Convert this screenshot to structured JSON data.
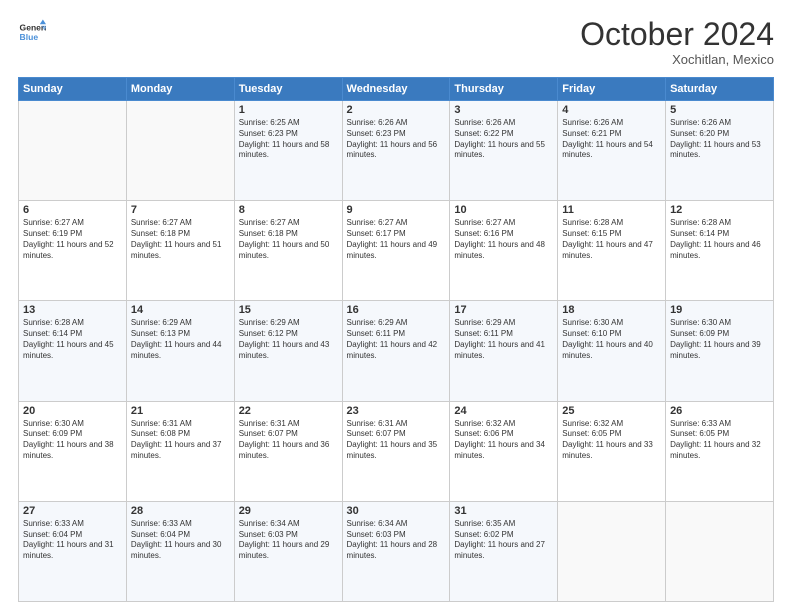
{
  "header": {
    "logo_line1": "General",
    "logo_line2": "Blue",
    "month": "October 2024",
    "location": "Xochitlan, Mexico"
  },
  "weekdays": [
    "Sunday",
    "Monday",
    "Tuesday",
    "Wednesday",
    "Thursday",
    "Friday",
    "Saturday"
  ],
  "weeks": [
    [
      {
        "day": "",
        "info": ""
      },
      {
        "day": "",
        "info": ""
      },
      {
        "day": "1",
        "info": "Sunrise: 6:25 AM\nSunset: 6:23 PM\nDaylight: 11 hours and 58 minutes."
      },
      {
        "day": "2",
        "info": "Sunrise: 6:26 AM\nSunset: 6:23 PM\nDaylight: 11 hours and 56 minutes."
      },
      {
        "day": "3",
        "info": "Sunrise: 6:26 AM\nSunset: 6:22 PM\nDaylight: 11 hours and 55 minutes."
      },
      {
        "day": "4",
        "info": "Sunrise: 6:26 AM\nSunset: 6:21 PM\nDaylight: 11 hours and 54 minutes."
      },
      {
        "day": "5",
        "info": "Sunrise: 6:26 AM\nSunset: 6:20 PM\nDaylight: 11 hours and 53 minutes."
      }
    ],
    [
      {
        "day": "6",
        "info": "Sunrise: 6:27 AM\nSunset: 6:19 PM\nDaylight: 11 hours and 52 minutes."
      },
      {
        "day": "7",
        "info": "Sunrise: 6:27 AM\nSunset: 6:18 PM\nDaylight: 11 hours and 51 minutes."
      },
      {
        "day": "8",
        "info": "Sunrise: 6:27 AM\nSunset: 6:18 PM\nDaylight: 11 hours and 50 minutes."
      },
      {
        "day": "9",
        "info": "Sunrise: 6:27 AM\nSunset: 6:17 PM\nDaylight: 11 hours and 49 minutes."
      },
      {
        "day": "10",
        "info": "Sunrise: 6:27 AM\nSunset: 6:16 PM\nDaylight: 11 hours and 48 minutes."
      },
      {
        "day": "11",
        "info": "Sunrise: 6:28 AM\nSunset: 6:15 PM\nDaylight: 11 hours and 47 minutes."
      },
      {
        "day": "12",
        "info": "Sunrise: 6:28 AM\nSunset: 6:14 PM\nDaylight: 11 hours and 46 minutes."
      }
    ],
    [
      {
        "day": "13",
        "info": "Sunrise: 6:28 AM\nSunset: 6:14 PM\nDaylight: 11 hours and 45 minutes."
      },
      {
        "day": "14",
        "info": "Sunrise: 6:29 AM\nSunset: 6:13 PM\nDaylight: 11 hours and 44 minutes."
      },
      {
        "day": "15",
        "info": "Sunrise: 6:29 AM\nSunset: 6:12 PM\nDaylight: 11 hours and 43 minutes."
      },
      {
        "day": "16",
        "info": "Sunrise: 6:29 AM\nSunset: 6:11 PM\nDaylight: 11 hours and 42 minutes."
      },
      {
        "day": "17",
        "info": "Sunrise: 6:29 AM\nSunset: 6:11 PM\nDaylight: 11 hours and 41 minutes."
      },
      {
        "day": "18",
        "info": "Sunrise: 6:30 AM\nSunset: 6:10 PM\nDaylight: 11 hours and 40 minutes."
      },
      {
        "day": "19",
        "info": "Sunrise: 6:30 AM\nSunset: 6:09 PM\nDaylight: 11 hours and 39 minutes."
      }
    ],
    [
      {
        "day": "20",
        "info": "Sunrise: 6:30 AM\nSunset: 6:09 PM\nDaylight: 11 hours and 38 minutes."
      },
      {
        "day": "21",
        "info": "Sunrise: 6:31 AM\nSunset: 6:08 PM\nDaylight: 11 hours and 37 minutes."
      },
      {
        "day": "22",
        "info": "Sunrise: 6:31 AM\nSunset: 6:07 PM\nDaylight: 11 hours and 36 minutes."
      },
      {
        "day": "23",
        "info": "Sunrise: 6:31 AM\nSunset: 6:07 PM\nDaylight: 11 hours and 35 minutes."
      },
      {
        "day": "24",
        "info": "Sunrise: 6:32 AM\nSunset: 6:06 PM\nDaylight: 11 hours and 34 minutes."
      },
      {
        "day": "25",
        "info": "Sunrise: 6:32 AM\nSunset: 6:05 PM\nDaylight: 11 hours and 33 minutes."
      },
      {
        "day": "26",
        "info": "Sunrise: 6:33 AM\nSunset: 6:05 PM\nDaylight: 11 hours and 32 minutes."
      }
    ],
    [
      {
        "day": "27",
        "info": "Sunrise: 6:33 AM\nSunset: 6:04 PM\nDaylight: 11 hours and 31 minutes."
      },
      {
        "day": "28",
        "info": "Sunrise: 6:33 AM\nSunset: 6:04 PM\nDaylight: 11 hours and 30 minutes."
      },
      {
        "day": "29",
        "info": "Sunrise: 6:34 AM\nSunset: 6:03 PM\nDaylight: 11 hours and 29 minutes."
      },
      {
        "day": "30",
        "info": "Sunrise: 6:34 AM\nSunset: 6:03 PM\nDaylight: 11 hours and 28 minutes."
      },
      {
        "day": "31",
        "info": "Sunrise: 6:35 AM\nSunset: 6:02 PM\nDaylight: 11 hours and 27 minutes."
      },
      {
        "day": "",
        "info": ""
      },
      {
        "day": "",
        "info": ""
      }
    ]
  ]
}
